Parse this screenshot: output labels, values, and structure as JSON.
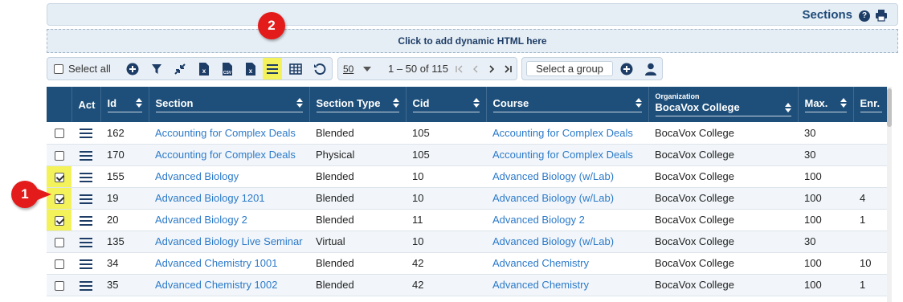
{
  "header": {
    "title": "Sections",
    "help_icon": "?"
  },
  "dynamic_bar": {
    "label": "Click to add dynamic HTML here"
  },
  "toolbar": {
    "select_all_label": "Select all",
    "icons": [
      "add-icon",
      "filter-icon",
      "collapse-icon",
      "excel-export-icon",
      "csv-export-icon",
      "excel-icon",
      "list-view-icon",
      "grid-view-icon",
      "refresh-icon"
    ]
  },
  "pager": {
    "page_size": "50",
    "range": "1 – 50 of 115"
  },
  "group": {
    "placeholder": "Select a group"
  },
  "callouts": {
    "one": "1",
    "two": "2"
  },
  "columns": {
    "act": "Act",
    "id": "Id",
    "section": "Section",
    "section_type": "Section Type",
    "cid": "Cid",
    "course": "Course",
    "org_small": "Organization",
    "org_value": "BocaVox College",
    "max": "Max.",
    "enr": "Enr."
  },
  "rows": [
    {
      "checked": false,
      "id": "162",
      "section": "Accounting for Complex Deals",
      "type": "Blended",
      "cid": "105",
      "course": "Accounting for Complex Deals",
      "org": "BocaVox College",
      "max": "30",
      "enr": ""
    },
    {
      "checked": false,
      "id": "170",
      "section": "Accounting for Complex Deals",
      "type": "Physical",
      "cid": "105",
      "course": "Accounting for Complex Deals",
      "org": "BocaVox College",
      "max": "30",
      "enr": ""
    },
    {
      "checked": true,
      "id": "155",
      "section": "Advanced Biology",
      "type": "Blended",
      "cid": "10",
      "course": "Advanced Biology (w/Lab)",
      "org": "BocaVox College",
      "max": "100",
      "enr": ""
    },
    {
      "checked": true,
      "id": "19",
      "section": "Advanced Biology 1201",
      "type": "Blended",
      "cid": "10",
      "course": "Advanced Biology (w/Lab)",
      "org": "BocaVox College",
      "max": "100",
      "enr": "4"
    },
    {
      "checked": true,
      "id": "20",
      "section": "Advanced Biology 2",
      "type": "Blended",
      "cid": "11",
      "course": "Advanced Biology 2",
      "org": "BocaVox College",
      "max": "100",
      "enr": "1"
    },
    {
      "checked": false,
      "id": "135",
      "section": "Advanced Biology Live Seminar",
      "type": "Virtual",
      "cid": "10",
      "course": "Advanced Biology (w/Lab)",
      "org": "BocaVox College",
      "max": "30",
      "enr": ""
    },
    {
      "checked": false,
      "id": "34",
      "section": "Advanced Chemistry 1001",
      "type": "Blended",
      "cid": "42",
      "course": "Advanced Chemistry",
      "org": "BocaVox College",
      "max": "100",
      "enr": "10"
    },
    {
      "checked": false,
      "id": "35",
      "section": "Advanced Chemistry 1002",
      "type": "Blended",
      "cid": "42",
      "course": "Advanced Chemistry",
      "org": "BocaVox College",
      "max": "100",
      "enr": "1"
    }
  ],
  "colors": {
    "header_bg": "#1e4f7a",
    "link": "#2c7ac9",
    "highlight": "#f3f25a",
    "callout": "#e31b1b"
  }
}
